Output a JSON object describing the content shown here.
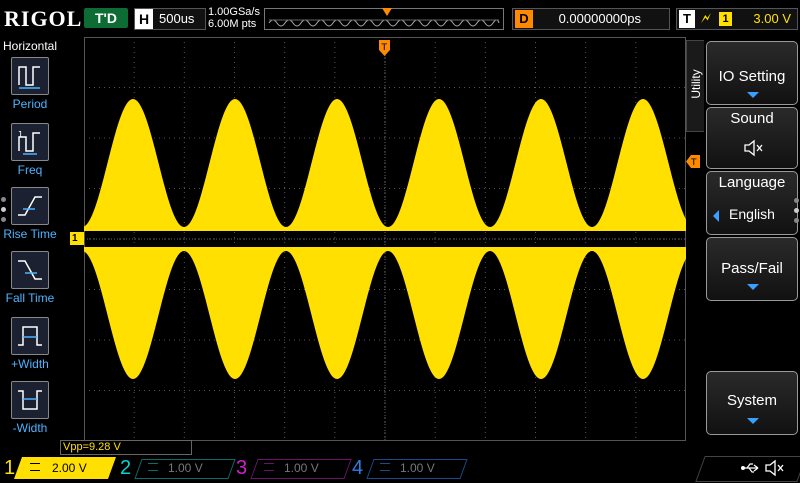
{
  "header": {
    "logo": "RIGOL",
    "run_status": "T'D",
    "horizontal_tag": "H",
    "timebase": "500us",
    "sample_rate": "1.00GSa/s",
    "memory_depth": "6.00M pts",
    "delay_tag": "D",
    "delay": "0.00000000ps",
    "trigger_tag": "T",
    "trigger_source": "1",
    "trigger_level": "3.00 V"
  },
  "left_panel": {
    "title": "Horizontal",
    "items": [
      {
        "label": "Period",
        "icon": "period-icon"
      },
      {
        "label": "Freq",
        "icon": "frequency-icon"
      },
      {
        "label": "Rise Time",
        "icon": "rise-time-icon"
      },
      {
        "label": "Fall Time",
        "icon": "fall-time-icon"
      },
      {
        "label": "+Width",
        "icon": "positive-width-icon"
      },
      {
        "label": "-Width",
        "icon": "negative-width-icon"
      }
    ]
  },
  "screen": {
    "ch1_marker": "1",
    "trigger_marker": "T",
    "trigger_level_marker": "T"
  },
  "right_menu": {
    "tab": "Utility",
    "buttons": [
      {
        "label": "IO Setting"
      },
      {
        "label": "Sound",
        "icon": "speaker-muted-icon"
      },
      {
        "label": "Language",
        "value": "English"
      },
      {
        "label": "Pass/Fail"
      },
      {
        "label": "System"
      }
    ]
  },
  "measurement": {
    "vpp": "Vpp=9.28 V"
  },
  "channels": [
    {
      "num": "1",
      "scale": "2.00 V",
      "color": "#ffe000",
      "active": true
    },
    {
      "num": "2",
      "scale": "1.00 V",
      "color": "#00d5d5",
      "active": false
    },
    {
      "num": "3",
      "scale": "1.00 V",
      "color": "#d21ed2",
      "active": false
    },
    {
      "num": "4",
      "scale": "1.00 V",
      "color": "#2c7ee6",
      "active": false
    }
  ],
  "status_icons": [
    "usb-icon",
    "speaker-muted-icon"
  ],
  "colors": {
    "ch1": "#ffe000",
    "accent": "#3aa0ff",
    "trigger": "#ff8a00",
    "run_status_bg": "#0d6b34"
  }
}
